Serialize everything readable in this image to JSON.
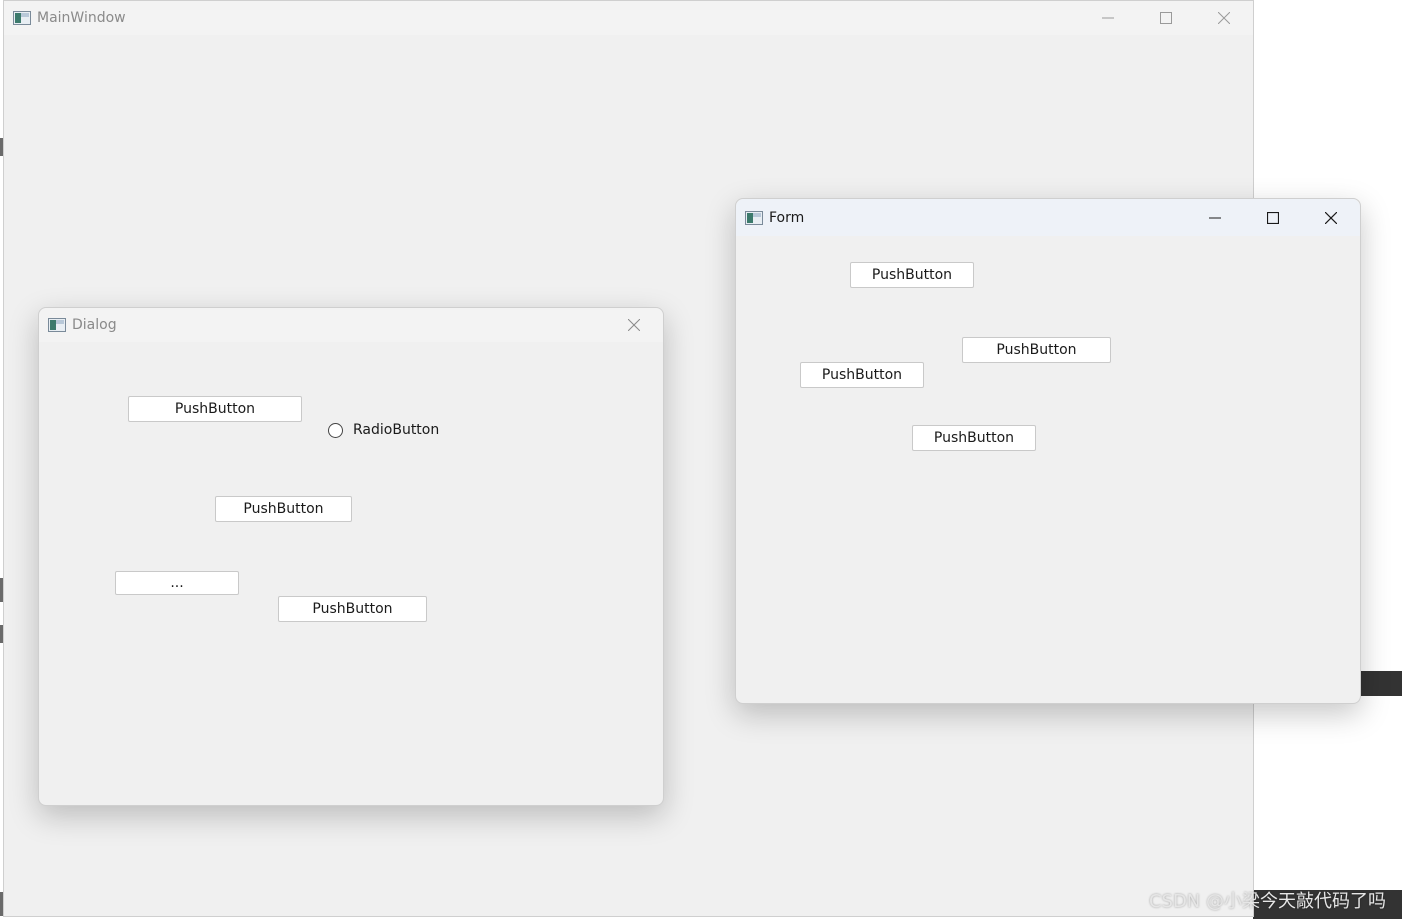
{
  "main_window": {
    "title": "MainWindow",
    "icon": "app-icon"
  },
  "dialog": {
    "title": "Dialog",
    "buttons": [
      "PushButton",
      "PushButton",
      "PushButton"
    ],
    "tool_button": "...",
    "radio_label": "RadioButton"
  },
  "form": {
    "title": "Form",
    "buttons": [
      "PushButton",
      "PushButton",
      "PushButton",
      "PushButton"
    ]
  },
  "watermark": "CSDN @小梁今天敲代码了吗",
  "colors": {
    "window_bg": "#f0f0f0",
    "active_titlebar": "#eef2f8",
    "button_bg": "#ffffff",
    "button_border": "#c9c9c9"
  }
}
